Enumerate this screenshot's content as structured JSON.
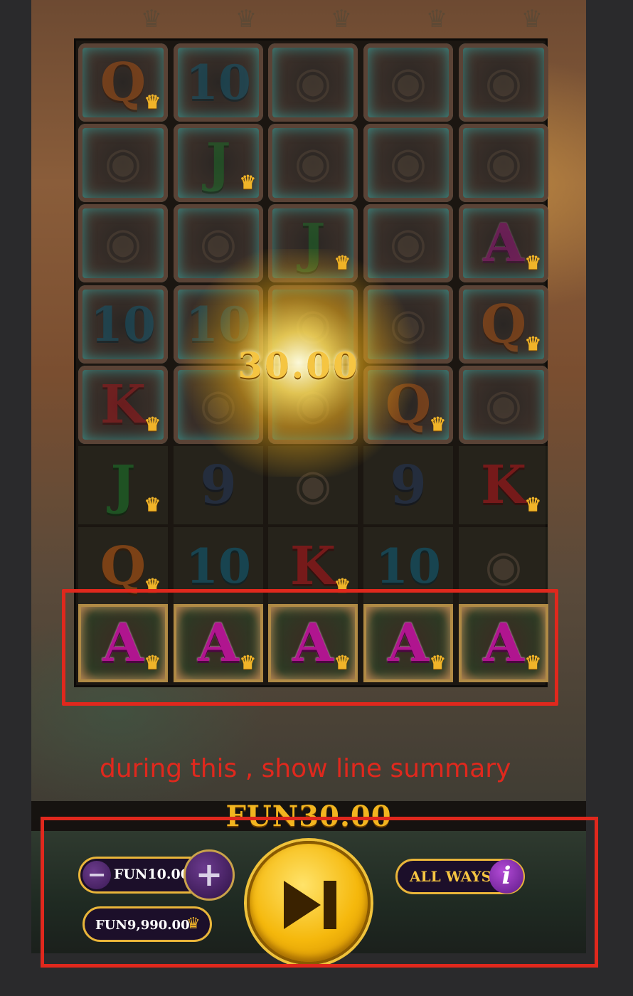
{
  "game": {
    "win_amount": "30.00",
    "total_win": "FUN30.00",
    "reels": [
      {
        "symbols": [
          "Q",
          "pic",
          "pic",
          "10",
          "K",
          "J",
          "Q",
          "A"
        ],
        "styles": [
          "stone",
          "stone",
          "stone",
          "stone",
          "stone",
          "plain",
          "plain",
          "win"
        ]
      },
      {
        "symbols": [
          "10",
          "J",
          "pic",
          "10",
          "pic",
          "9",
          "10",
          "A"
        ],
        "styles": [
          "stone",
          "stone",
          "stone",
          "stone",
          "stone",
          "plain",
          "plain",
          "win"
        ]
      },
      {
        "symbols": [
          "pic",
          "pic",
          "J",
          "pic",
          "pic",
          "pic",
          "K",
          "A"
        ],
        "styles": [
          "stone",
          "stone",
          "stone",
          "stone",
          "stone",
          "plain",
          "plain",
          "win"
        ]
      },
      {
        "symbols": [
          "pic",
          "pic",
          "pic",
          "pic",
          "Q",
          "9",
          "10",
          "A"
        ],
        "styles": [
          "stone",
          "stone",
          "stone",
          "stone",
          "stone",
          "plain",
          "plain",
          "win"
        ]
      },
      {
        "symbols": [
          "pic",
          "pic",
          "A",
          "Q",
          "pic",
          "K",
          "pic",
          "A"
        ],
        "styles": [
          "stone",
          "stone",
          "stone",
          "stone",
          "stone",
          "plain",
          "plain",
          "win"
        ]
      }
    ]
  },
  "annotation": {
    "text": "during this , show line summary",
    "color": "#e0281d"
  },
  "controls": {
    "stake": "FUN10.00",
    "minus_symbol": "−",
    "plus_symbol": "+",
    "balance": "FUN9,990.00",
    "spin_icon": "skip-forward-icon",
    "all_ways_label": "ALL WAYS",
    "info_symbol": "i"
  },
  "colors": {
    "accent_gold": "#f5c542",
    "panel_border": "#e9b53a",
    "pill_bg": "#1c0f2a"
  }
}
